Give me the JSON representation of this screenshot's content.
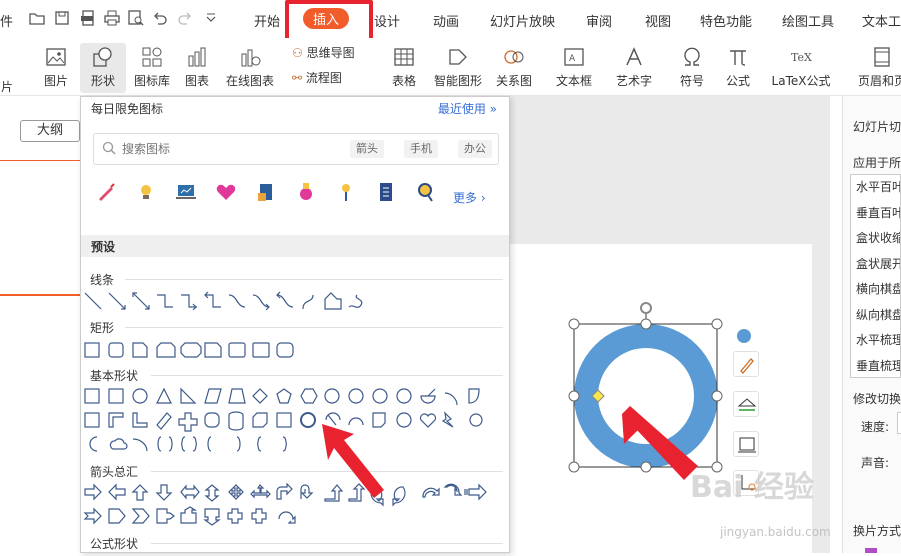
{
  "quick_access": [
    "folder-icon",
    "save-icon",
    "pdf-icon",
    "print-icon",
    "preview-icon",
    "undo-icon",
    "redo-icon",
    "dropdown-icon"
  ],
  "left_edge_label": "件",
  "menu": {
    "tabs": [
      "开始",
      "插入",
      "设计",
      "动画",
      "幻灯片放映",
      "审阅",
      "视图",
      "特色功能",
      "绘图工具",
      "文本工"
    ],
    "active": "插入"
  },
  "ribbon": {
    "cut_label": "片",
    "picture": "图片",
    "shape": "形状",
    "icon_lib": "图标库",
    "chart": "图表",
    "online_chart": "在线图表",
    "mindmap": "思维导图",
    "flowchart": "流程图",
    "table": "表格",
    "smart_graphic": "智能图形",
    "relation": "关系图",
    "textbox": "文本框",
    "wordart": "艺术字",
    "symbol": "符号",
    "formula": "公式",
    "latex": "LaTeX公式",
    "header_footer": "页眉和页"
  },
  "left": {
    "view_label": "大纲"
  },
  "dropdown": {
    "title": "每日限免图标",
    "recent": "最近使用",
    "search_placeholder": "搜索图标",
    "tags": [
      "箭头",
      "手机",
      "办公"
    ],
    "more": "更多",
    "preset": "预设",
    "categories": [
      "线条",
      "矩形",
      "基本形状",
      "箭头总汇",
      "公式形状"
    ]
  },
  "right_panel": {
    "title": "幻灯片切",
    "apply_label": "应用于所",
    "items": [
      "水平百叶",
      "垂直百叶",
      "盒状收缩",
      "盒状展开",
      "横向棋盘",
      "纵向棋盘",
      "水平梳理",
      "垂直梳理"
    ],
    "modify": "修改切换",
    "speed": "速度:",
    "sound": "声音:",
    "switch_mode": "换片方式"
  },
  "watermark": {
    "main": "Bai 经验",
    "sub": "jingyan.baidu.com"
  },
  "colors": {
    "accent": "#f25c2a",
    "highlight": "#e8232f",
    "donut": "#5b9bd5",
    "link": "#3a6fd6"
  }
}
